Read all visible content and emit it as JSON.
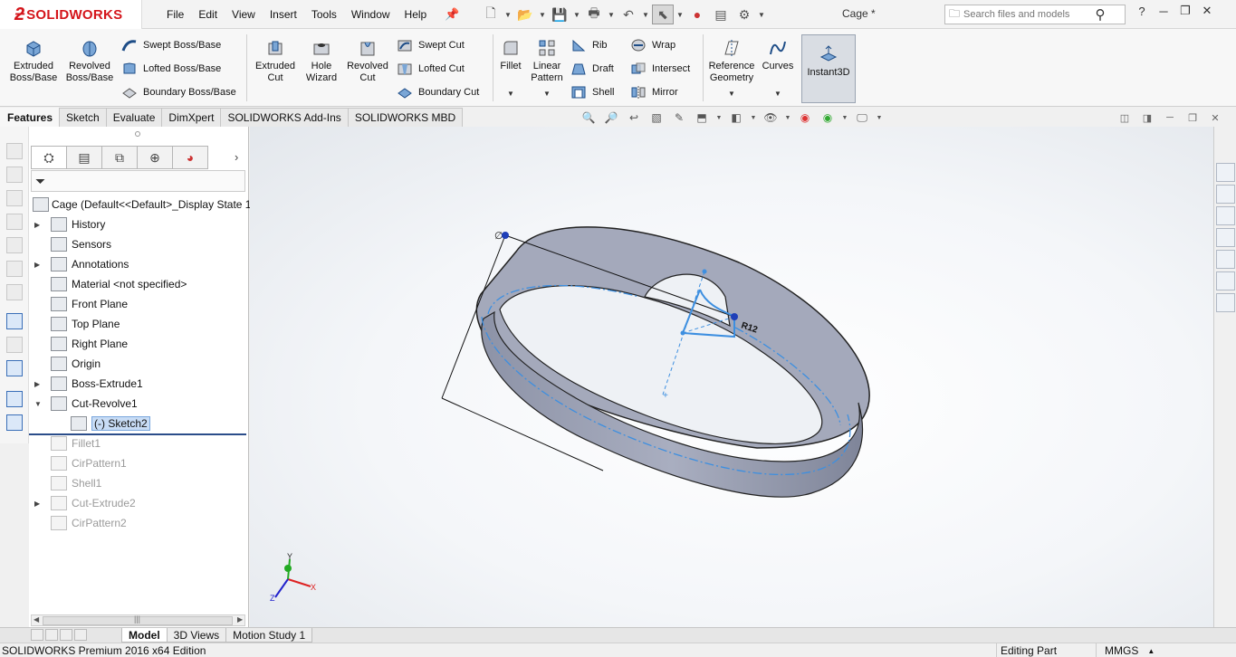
{
  "app": {
    "brand": "SOLIDWORKS",
    "document_title": "Cage *",
    "search_placeholder": "Search files and models"
  },
  "menu": [
    "File",
    "Edit",
    "View",
    "Insert",
    "Tools",
    "Window",
    "Help"
  ],
  "command_manager": {
    "big_buttons": [
      {
        "label": "Extruded\nBoss/Base",
        "icon": "extrude-icon"
      },
      {
        "label": "Revolved\nBoss/Base",
        "icon": "revolve-icon"
      },
      {
        "label": "Extruded\nCut",
        "icon": "extrude-cut-icon"
      },
      {
        "label": "Hole\nWizard",
        "icon": "hole-wizard-icon"
      },
      {
        "label": "Revolved\nCut",
        "icon": "revolve-cut-icon"
      },
      {
        "label": "Fillet",
        "icon": "fillet-icon"
      },
      {
        "label": "Linear\nPattern",
        "icon": "linear-pattern-icon"
      },
      {
        "label": "Reference\nGeometry",
        "icon": "reference-geometry-icon"
      },
      {
        "label": "Curves",
        "icon": "curves-icon"
      },
      {
        "label": "Instant3D",
        "icon": "instant3d-icon"
      }
    ],
    "small_buttons": [
      {
        "label": "Swept Boss/Base",
        "icon": "swept-boss-icon"
      },
      {
        "label": "Lofted Boss/Base",
        "icon": "lofted-boss-icon"
      },
      {
        "label": "Boundary Boss/Base",
        "icon": "boundary-boss-icon"
      },
      {
        "label": "Swept Cut",
        "icon": "swept-cut-icon"
      },
      {
        "label": "Lofted Cut",
        "icon": "lofted-cut-icon"
      },
      {
        "label": "Boundary Cut",
        "icon": "boundary-cut-icon"
      },
      {
        "label": "Rib",
        "icon": "rib-icon"
      },
      {
        "label": "Draft",
        "icon": "draft-icon"
      },
      {
        "label": "Shell",
        "icon": "shell-icon"
      },
      {
        "label": "Wrap",
        "icon": "wrap-icon"
      },
      {
        "label": "Intersect",
        "icon": "intersect-icon"
      },
      {
        "label": "Mirror",
        "icon": "mirror-icon"
      }
    ]
  },
  "tabs": [
    "Features",
    "Sketch",
    "Evaluate",
    "DimXpert",
    "SOLIDWORKS Add-Ins",
    "SOLIDWORKS MBD"
  ],
  "feature_tree": {
    "root": "Cage  (Default<<Default>_Display State 1",
    "items": [
      {
        "label": "History",
        "expandable": true,
        "state": "normal",
        "icon": "history-folder-icon"
      },
      {
        "label": "Sensors",
        "expandable": false,
        "state": "normal",
        "icon": "sensors-icon"
      },
      {
        "label": "Annotations",
        "expandable": true,
        "state": "normal",
        "icon": "annotations-icon"
      },
      {
        "label": "Material <not specified>",
        "expandable": false,
        "state": "normal",
        "icon": "material-icon"
      },
      {
        "label": "Front Plane",
        "expandable": false,
        "state": "normal",
        "icon": "plane-icon"
      },
      {
        "label": "Top Plane",
        "expandable": false,
        "state": "normal",
        "icon": "plane-icon"
      },
      {
        "label": "Right Plane",
        "expandable": false,
        "state": "normal",
        "icon": "plane-icon"
      },
      {
        "label": "Origin",
        "expandable": false,
        "state": "normal",
        "icon": "origin-icon"
      },
      {
        "label": "Boss-Extrude1",
        "expandable": true,
        "state": "normal",
        "icon": "extrude-feature-icon"
      },
      {
        "label": "Cut-Revolve1",
        "expandable": true,
        "expanded": true,
        "state": "normal",
        "icon": "revolve-cut-feature-icon"
      },
      {
        "label": "(-) Sketch2",
        "expandable": false,
        "state": "selected",
        "child": true,
        "icon": "sketch-icon"
      },
      {
        "label": "Fillet1",
        "expandable": false,
        "state": "suppressed",
        "icon": "fillet-feature-icon"
      },
      {
        "label": "CirPattern1",
        "expandable": false,
        "state": "suppressed",
        "icon": "circular-pattern-icon"
      },
      {
        "label": "Shell1",
        "expandable": false,
        "state": "suppressed",
        "icon": "shell-feature-icon"
      },
      {
        "label": "Cut-Extrude2",
        "expandable": true,
        "state": "suppressed",
        "icon": "cut-extrude-feature-icon"
      },
      {
        "label": "CirPattern2",
        "expandable": false,
        "state": "suppressed",
        "icon": "circular-pattern-icon"
      }
    ]
  },
  "viewport": {
    "dimension_label": "R12",
    "triad": {
      "x": "X",
      "y": "Y",
      "z": "Z"
    },
    "colors": {
      "part": "#9aa0b3",
      "sketch": "#3d8fe0",
      "point": "#1f3fb8"
    }
  },
  "bottom_tabs": [
    "Model",
    "3D Views",
    "Motion Study 1"
  ],
  "status": {
    "edition": "SOLIDWORKS Premium 2016 x64 Edition",
    "mode": "Editing Part",
    "units": "MMGS"
  }
}
